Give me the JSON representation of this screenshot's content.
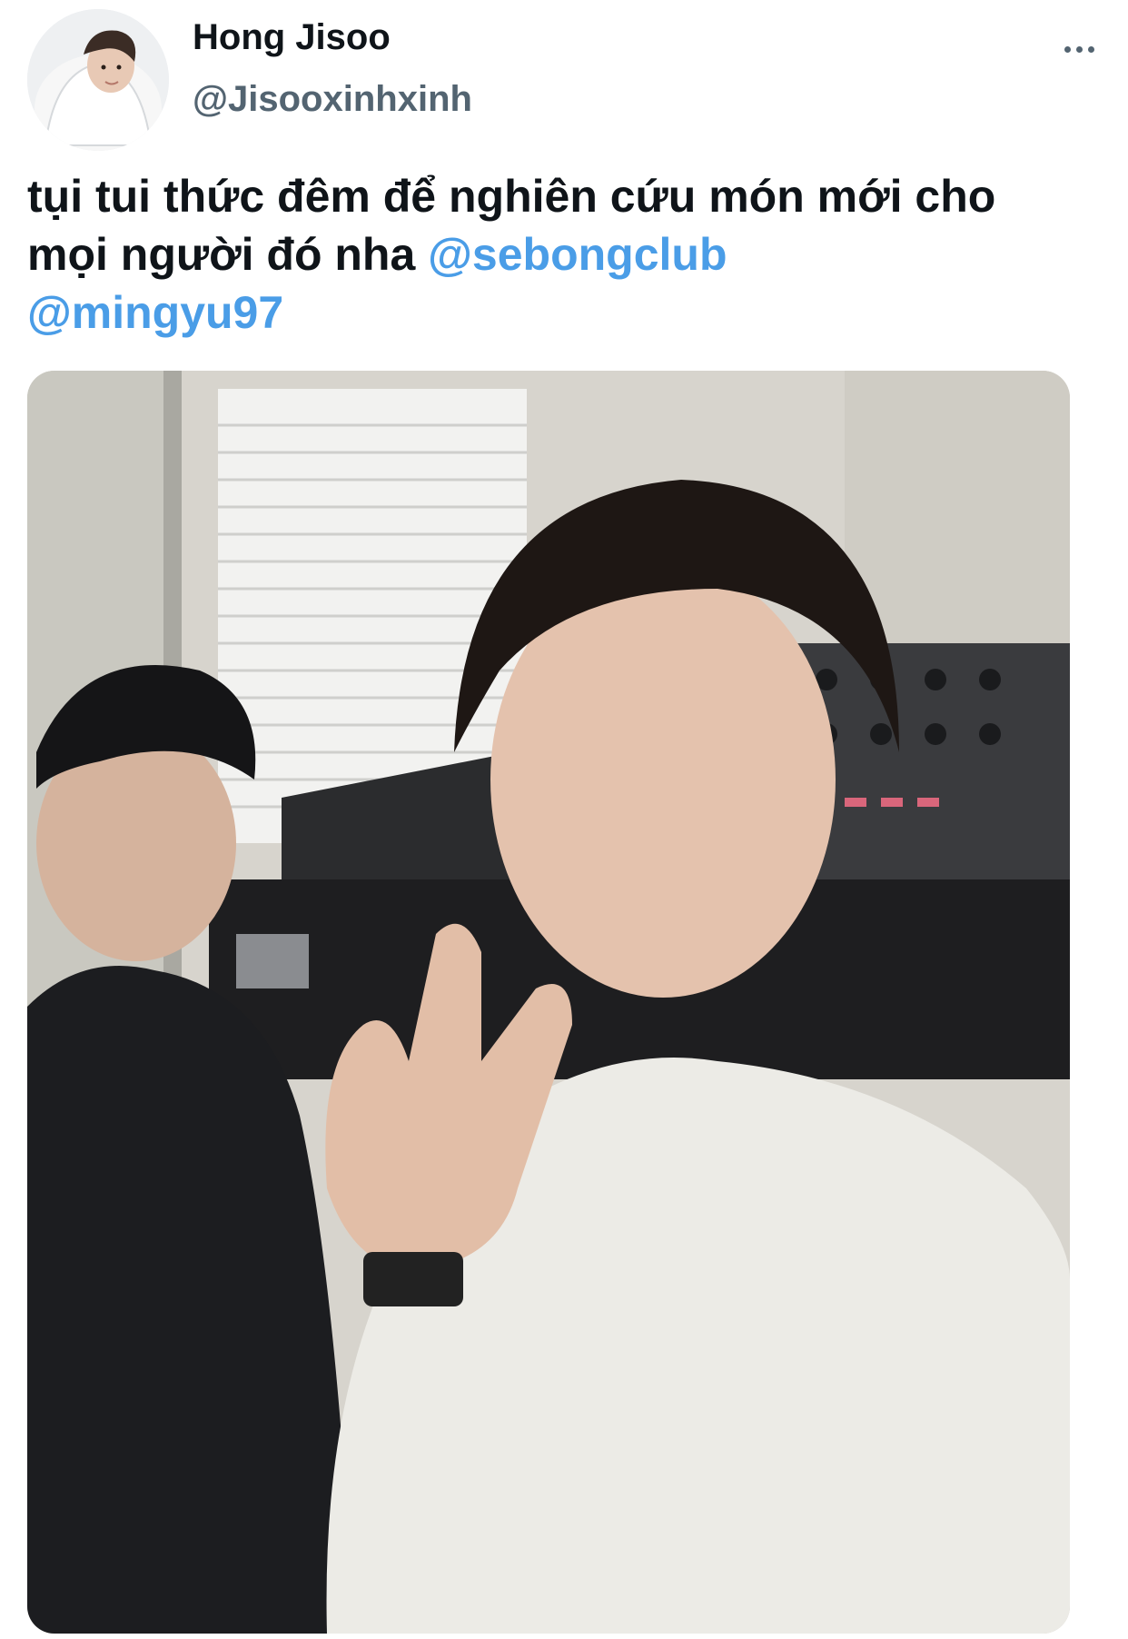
{
  "author": {
    "display_name": "Hong Jisoo",
    "handle": "@Jisooxinhxinh"
  },
  "tweet": {
    "text_main": "tụi tui thức đêm để nghiên cứu món mới cho mọi người đó nha ",
    "mentions": [
      "@sebongclub",
      "@mingyu97"
    ]
  },
  "icons": {
    "more": "more-horizontal-icon"
  },
  "colors": {
    "mention": "#4a9de7",
    "text": "#0f1419",
    "secondary": "#536471"
  }
}
